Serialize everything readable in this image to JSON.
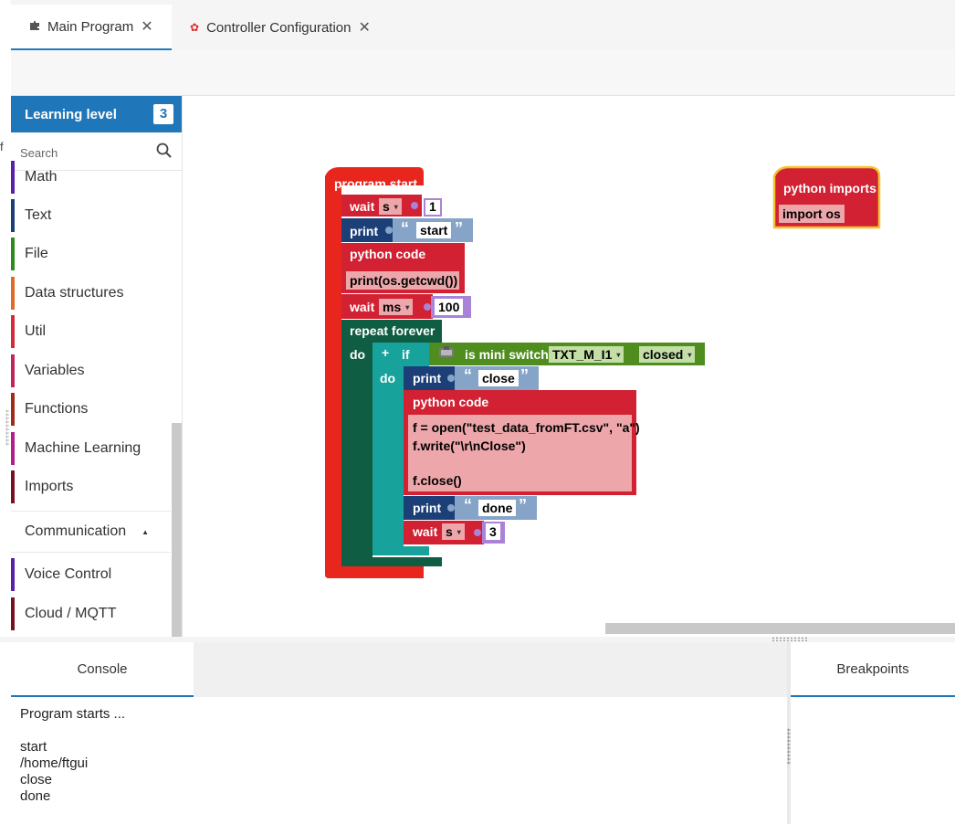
{
  "tabs": [
    {
      "label": "Main Program",
      "icon": "puzzle-icon",
      "active": true
    },
    {
      "label": "Controller Configuration",
      "icon": "gear-icon",
      "active": false
    }
  ],
  "palette": {
    "level_label": "Learning level",
    "level_value": "3",
    "search_placeholder": "Search",
    "categories": [
      {
        "label": "Math",
        "color": "#5b1fa8"
      },
      {
        "label": "Text",
        "color": "#1c3f78"
      },
      {
        "label": "File",
        "color": "#2e8a1f"
      },
      {
        "label": "Data structures",
        "color": "#e06a2a"
      },
      {
        "label": "Util",
        "color": "#d42a3a"
      },
      {
        "label": "Variables",
        "color": "#c0245a"
      },
      {
        "label": "Functions",
        "color": "#a12b1a"
      },
      {
        "label": "Machine Learning",
        "color": "#b21e8a"
      },
      {
        "label": "Imports",
        "color": "#7a1024"
      }
    ],
    "group": {
      "label": "Communication",
      "arrow": "▲"
    },
    "group_items": [
      {
        "label": "Voice Control",
        "color": "#5b1fa8"
      },
      {
        "label": "Cloud / MQTT",
        "color": "#7a1024"
      }
    ]
  },
  "workspace": {
    "program_start": "program start",
    "wait1": {
      "label": "wait",
      "unit": "s",
      "value": "1"
    },
    "print1": {
      "label": "print",
      "text": "start"
    },
    "python1": {
      "label": "python code",
      "code": "print(os.getcwd())"
    },
    "wait2": {
      "label": "wait",
      "unit": "ms",
      "value": "100"
    },
    "repeat": {
      "label": "repeat forever",
      "do": "do"
    },
    "if_block": {
      "plus": "+",
      "label": "if",
      "do": "do"
    },
    "condition": {
      "label": "is mini switch",
      "input": "TXT_M_I1",
      "state": "closed"
    },
    "print2": {
      "label": "print",
      "text": "close"
    },
    "python2": {
      "label": "python code",
      "code": [
        "f = open(\"test_data_fromFT.csv\", \"a\")",
        "f.write(\"\\r\\nClose\")",
        "",
        "f.close()"
      ]
    },
    "print3": {
      "label": "print",
      "text": "done"
    },
    "wait3": {
      "label": "wait",
      "unit": "s",
      "value": "3"
    },
    "python_imports": {
      "label": "python imports",
      "code": "import os"
    }
  },
  "console": {
    "tab_label": "Console",
    "lines": [
      "Program starts ...",
      "",
      "start",
      "/home/ftgui",
      "close",
      "done"
    ]
  },
  "breakpoints": {
    "tab_label": "Breakpoints"
  },
  "edge_fragment": "f",
  "colors": {
    "accent": "#1f77b9",
    "program_start": "#e8261d",
    "wait": "#d12132",
    "print": "#1c3f78",
    "text_field": "#86a3c8",
    "python": "#d12132",
    "code_field": "#eda6aa",
    "repeat": "#0f5e43",
    "if": "#17a39b",
    "condition": "#4f8d1f",
    "number_field": "#a983d8",
    "imports_border": "#f4c430"
  }
}
